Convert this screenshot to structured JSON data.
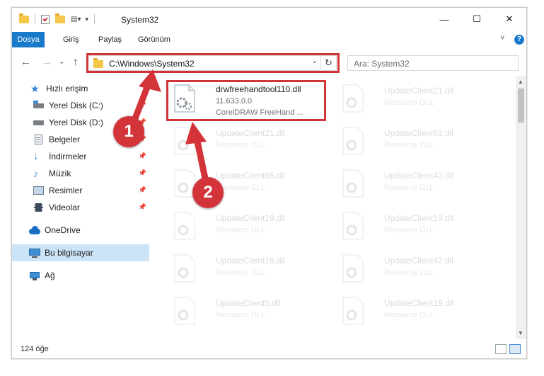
{
  "window": {
    "title": "System32",
    "minimize": "—",
    "maximize": "☐",
    "close": "✕"
  },
  "ribbon": {
    "tabs": [
      {
        "label": "Dosya",
        "active": true
      },
      {
        "label": "Giriş"
      },
      {
        "label": "Paylaş"
      },
      {
        "label": "Görünüm"
      }
    ],
    "help": "?",
    "collapse": "˅"
  },
  "address": {
    "path": "C:\\Windows\\System32",
    "search_placeholder": "Ara: System32",
    "refresh": "↻",
    "dropdown": "⌄"
  },
  "nav": {
    "back": "←",
    "forward": "→",
    "recent": "⌄",
    "up": "↑"
  },
  "sidebar": {
    "items": [
      {
        "label": "Hızlı erişim",
        "icon": "star-icon"
      },
      {
        "label": "Yerel Disk (C:)",
        "icon": "disk-icon",
        "pinned": true
      },
      {
        "label": "Yerel Disk (D:)",
        "icon": "disk-icon",
        "pinned": true
      },
      {
        "label": "Belgeler",
        "icon": "documents-icon",
        "pinned": true
      },
      {
        "label": "İndirmeler",
        "icon": "download-icon",
        "pinned": true
      },
      {
        "label": "Müzik",
        "icon": "music-icon",
        "pinned": true
      },
      {
        "label": "Resimler",
        "icon": "pictures-icon",
        "pinned": true
      },
      {
        "label": "Videolar",
        "icon": "videos-icon",
        "pinned": true
      },
      {
        "label": "OneDrive",
        "icon": "cloud-icon"
      },
      {
        "label": "Bu bilgisayar",
        "icon": "computer-icon",
        "selected": true
      },
      {
        "label": "Ağ",
        "icon": "network-icon"
      }
    ]
  },
  "files": [
    {
      "name": "drwfreehandtool110.dll",
      "version": "11.633.0.0",
      "desc": "CorelDRAW FreeHand ...",
      "highlight": true
    },
    {
      "name": "UpdateClient21.dll",
      "desc": "Resource DLL"
    },
    {
      "name": "UpdateClient21.dll",
      "desc": "Resource DLL"
    },
    {
      "name": "UpdateClient63.dll",
      "desc": "Resource DLL"
    },
    {
      "name": "UpdateClient65.dll",
      "desc": "Resource DLL"
    },
    {
      "name": "UpdateClient42.dll",
      "desc": "Resource DLL"
    },
    {
      "name": "UpdateClient19.dll",
      "desc": "Resource DLL"
    },
    {
      "name": "UpdateClient19.dll",
      "desc": "Resource DLL"
    },
    {
      "name": "UpdateClient19.dll",
      "desc": "Resource DLL"
    },
    {
      "name": "UpdateClient42.dll",
      "desc": "Resource DLL"
    },
    {
      "name": "UpdateClient5.dll",
      "desc": "Resource DLL"
    },
    {
      "name": "UpdateClient19.dll",
      "desc": "Resource DLL"
    }
  ],
  "status": {
    "count": "124 öğe"
  },
  "annotations": {
    "step1": "1",
    "step2": "2",
    "color": "#d3343a"
  }
}
